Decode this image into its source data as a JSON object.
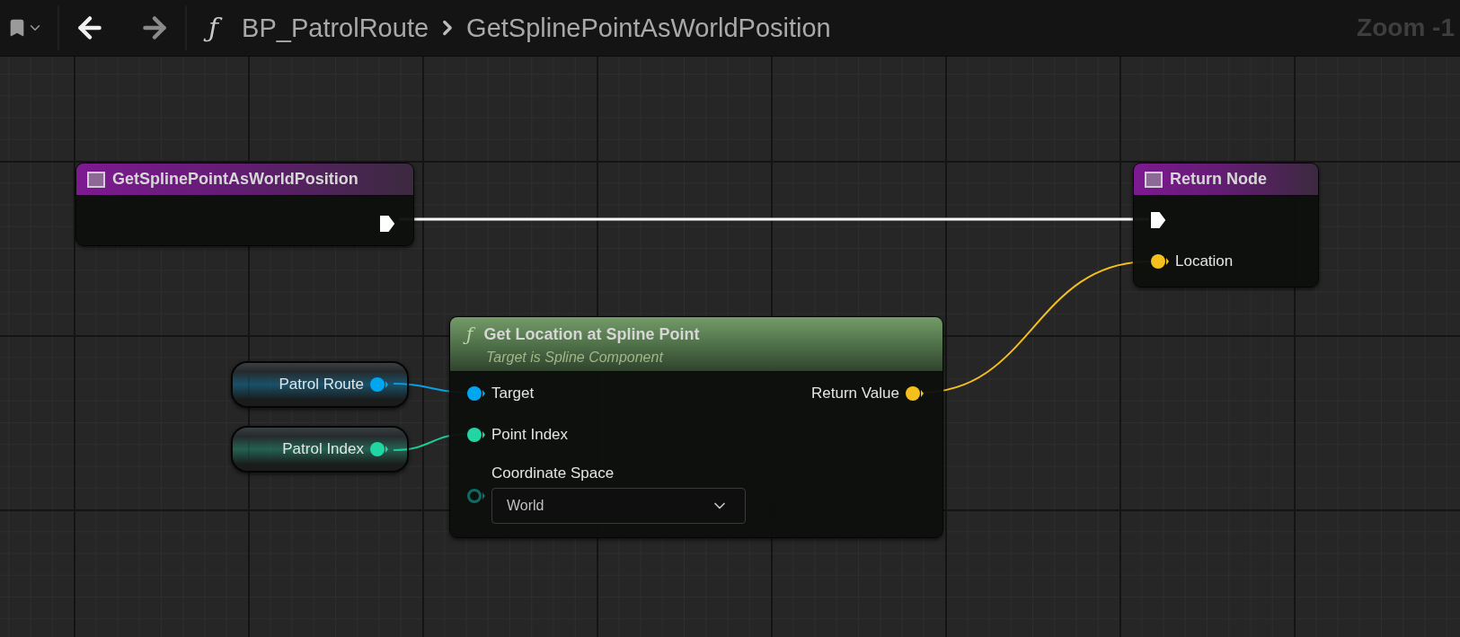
{
  "toolbar": {
    "icon": "ƒ",
    "breadcrumb": [
      "BP_PatrolRoute",
      "GetSplinePointAsWorldPosition"
    ],
    "zoom": "Zoom -1"
  },
  "nodes": [
    {
      "kind": "entry",
      "title": "GetSplinePointAsWorldPosition",
      "outputs": [
        {
          "kind": "exec",
          "connected": true
        }
      ]
    },
    {
      "kind": "return",
      "title": "Return Node",
      "inputs": [
        {
          "kind": "exec",
          "connected": true
        },
        {
          "kind": "data",
          "label": "Location",
          "color": "#f4c01e",
          "connected": true
        }
      ]
    },
    {
      "kind": "function",
      "icon": "ƒ",
      "title": "Get Location at Spline Point",
      "subtitle": "Target is Spline Component",
      "inputs": [
        {
          "kind": "data",
          "label": "Target",
          "color": "#00a6f0",
          "connected": true
        },
        {
          "kind": "data",
          "label": "Point Index",
          "color": "#22d6a4",
          "connected": true
        },
        {
          "kind": "enum",
          "label": "Coordinate Space",
          "color": "#0f6a62",
          "connected": false,
          "value": "World"
        }
      ],
      "outputs": [
        {
          "kind": "data",
          "label": "Return Value",
          "color": "#f4c01e",
          "connected": true
        }
      ]
    },
    {
      "kind": "variable",
      "label": "Patrol Route",
      "color": "#00a6f0"
    },
    {
      "kind": "variable",
      "label": "Patrol Index",
      "color": "#22d6a4"
    }
  ],
  "wires": [
    {
      "kind": "exec",
      "color": "#ffffff"
    },
    {
      "kind": "data",
      "color": "#f4c01e"
    },
    {
      "kind": "data",
      "color": "#0a9fe0"
    },
    {
      "kind": "data",
      "color": "#1fc99a"
    }
  ]
}
